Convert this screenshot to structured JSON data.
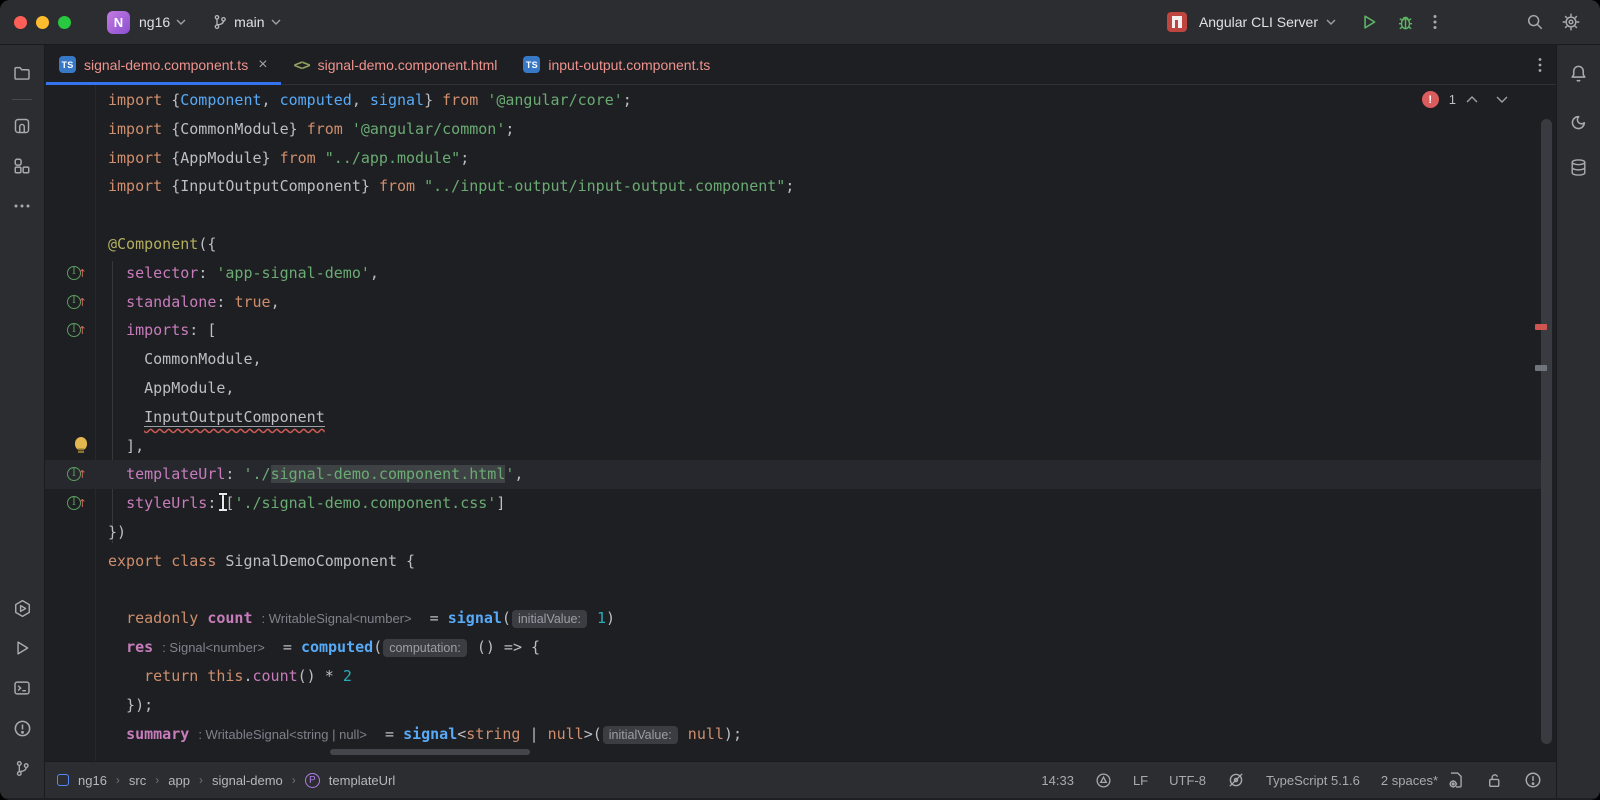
{
  "colors": {
    "accent": "#3574f0",
    "error": "#db5c5c",
    "error_file_tab": "#ef938e",
    "editor_bg": "#1e1f22",
    "chrome_bg": "#2b2d30",
    "string_green": "#6aab73",
    "keyword_orange": "#cf8e6d",
    "function_blue": "#57aaf7",
    "field_purple": "#c77dbb",
    "decorator_yellow": "#b3ae60",
    "number_teal": "#2aacb8"
  },
  "header": {
    "project": "ng16",
    "branch": "main",
    "run_config": "Angular CLI Server"
  },
  "tabs": [
    {
      "label": "signal-demo.component.ts",
      "type": "typescript",
      "active": true,
      "close": "×"
    },
    {
      "label": "signal-demo.component.html",
      "type": "html",
      "icon_glyph": "<>",
      "active": false
    },
    {
      "label": "input-output.component.ts",
      "type": "typescript",
      "active": false
    }
  ],
  "icons": {
    "left_strip": [
      "project-folder",
      "commit",
      "structure",
      "more"
    ],
    "left_strip_bottom": [
      "services",
      "run",
      "terminal",
      "problems",
      "version-control"
    ],
    "right_strip": [
      "notifications-bell",
      "ai-assistant",
      "database"
    ],
    "titlebar_right": [
      "npm",
      "run-play",
      "debug-bug",
      "more-kebab",
      "search-magnifier",
      "settings-gear"
    ],
    "statusbar_right": [
      "analyzer-circle",
      "inspections-eye-off",
      "file-types-gear",
      "unlocked-padlock",
      "error-info-circle"
    ]
  },
  "editor": {
    "inspection": {
      "errors": "1"
    },
    "lines": [
      {
        "segs": [
          [
            "k",
            "import "
          ],
          [
            "p",
            "{"
          ],
          [
            "f",
            "Component"
          ],
          [
            "p",
            ", "
          ],
          [
            "f",
            "computed"
          ],
          [
            "p",
            ", "
          ],
          [
            "f",
            "signal"
          ],
          [
            "p",
            "} "
          ],
          [
            "k",
            "from "
          ],
          [
            "s",
            "'@angular/core'"
          ],
          [
            "p",
            ";"
          ]
        ]
      },
      {
        "segs": [
          [
            "k",
            "import "
          ],
          [
            "p",
            "{CommonModule} "
          ],
          [
            "k",
            "from "
          ],
          [
            "s",
            "'@angular/common'"
          ],
          [
            "p",
            ";"
          ]
        ]
      },
      {
        "segs": [
          [
            "k",
            "import "
          ],
          [
            "p",
            "{AppModule} "
          ],
          [
            "k",
            "from "
          ],
          [
            "s",
            "\"../app.module\""
          ],
          [
            "p",
            ";"
          ]
        ]
      },
      {
        "segs": [
          [
            "k",
            "import "
          ],
          [
            "p",
            "{InputOutputComponent} "
          ],
          [
            "k",
            "from "
          ],
          [
            "s",
            "\"../input-output/input-output.component\""
          ],
          [
            "p",
            ";"
          ]
        ]
      },
      {
        "segs": []
      },
      {
        "segs": [
          [
            "d",
            "@Component"
          ],
          [
            "p",
            "({"
          ]
        ]
      },
      {
        "gutter": true,
        "segs": [
          [
            "p",
            "  "
          ],
          [
            "v",
            "selector"
          ],
          [
            "p",
            ": "
          ],
          [
            "s",
            "'app-signal-demo'"
          ],
          [
            "p",
            ","
          ]
        ]
      },
      {
        "gutter": true,
        "segs": [
          [
            "p",
            "  "
          ],
          [
            "v",
            "standalone"
          ],
          [
            "p",
            ": "
          ],
          [
            "k",
            "true"
          ],
          [
            "p",
            ","
          ]
        ]
      },
      {
        "gutter": true,
        "segs": [
          [
            "p",
            "  "
          ],
          [
            "v",
            "imports"
          ],
          [
            "p",
            ": ["
          ]
        ]
      },
      {
        "segs": [
          [
            "p",
            "    CommonModule,"
          ]
        ]
      },
      {
        "segs": [
          [
            "p",
            "    AppModule,"
          ]
        ]
      },
      {
        "segs": [
          [
            "p",
            "    "
          ],
          [
            "e",
            "InputOutputComponent"
          ]
        ]
      },
      {
        "bulb": true,
        "segs": [
          [
            "p",
            "  ],"
          ]
        ]
      },
      {
        "gutter": true,
        "current": true,
        "segs": [
          [
            "p",
            "  "
          ],
          [
            "v",
            "templateUrl"
          ],
          [
            "p",
            ": "
          ],
          [
            "s",
            "'./"
          ],
          [
            "shl",
            "signal-demo.component.html"
          ],
          [
            "s",
            "'"
          ],
          [
            "p",
            ","
          ]
        ]
      },
      {
        "gutter": true,
        "segs": [
          [
            "p",
            "  "
          ],
          [
            "v",
            "styleUrls"
          ],
          [
            "p",
            ": ["
          ],
          [
            "s",
            "'./signal-demo.component.css'"
          ],
          [
            "p",
            "]"
          ]
        ]
      },
      {
        "segs": [
          [
            "p",
            "})"
          ]
        ]
      },
      {
        "segs": [
          [
            "k",
            "export "
          ],
          [
            "k",
            "class "
          ],
          [
            "p",
            "SignalDemoComponent {"
          ]
        ]
      },
      {
        "segs": []
      },
      {
        "segs": [
          [
            "p",
            "  "
          ],
          [
            "k",
            "readonly "
          ],
          [
            "vb",
            "count "
          ],
          [
            "h",
            ": WritableSignal<number>"
          ],
          [
            "p",
            "  = "
          ],
          [
            "fb",
            "signal"
          ],
          [
            "p",
            "("
          ],
          [
            "hb",
            "initialValue:"
          ],
          [
            "p",
            " "
          ],
          [
            "n",
            "1"
          ],
          [
            "p",
            ")"
          ]
        ]
      },
      {
        "segs": [
          [
            "p",
            "  "
          ],
          [
            "vb",
            "res "
          ],
          [
            "h",
            ": Signal<number>"
          ],
          [
            "p",
            "  = "
          ],
          [
            "fb",
            "computed"
          ],
          [
            "p",
            "("
          ],
          [
            "hb",
            "computation:"
          ],
          [
            "p",
            " () => {"
          ]
        ]
      },
      {
        "segs": [
          [
            "p",
            "    "
          ],
          [
            "k",
            "return "
          ],
          [
            "k",
            "this"
          ],
          [
            "p",
            "."
          ],
          [
            "v",
            "count"
          ],
          [
            "p",
            "() * "
          ],
          [
            "n",
            "2"
          ]
        ]
      },
      {
        "segs": [
          [
            "p",
            "  });"
          ]
        ]
      },
      {
        "segs": [
          [
            "p",
            "  "
          ],
          [
            "vb",
            "summary "
          ],
          [
            "h",
            ": WritableSignal<string | null>"
          ],
          [
            "p",
            "  = "
          ],
          [
            "fb",
            "signal"
          ],
          [
            "p",
            "<"
          ],
          [
            "k",
            "string"
          ],
          [
            "p",
            " | "
          ],
          [
            "k",
            "null"
          ],
          [
            "p",
            ">("
          ],
          [
            "hb",
            "initialValue:"
          ],
          [
            "p",
            " "
          ],
          [
            "k",
            "null"
          ],
          [
            "p",
            ");"
          ]
        ]
      }
    ]
  },
  "statusbar": {
    "breadcrumbs": [
      "ng16",
      "src",
      "app",
      "signal-demo",
      "templateUrl"
    ],
    "position": "14:33",
    "line_separator": "LF",
    "encoding": "UTF-8",
    "language_version": "TypeScript 5.1.6",
    "indent": "2 spaces*"
  }
}
